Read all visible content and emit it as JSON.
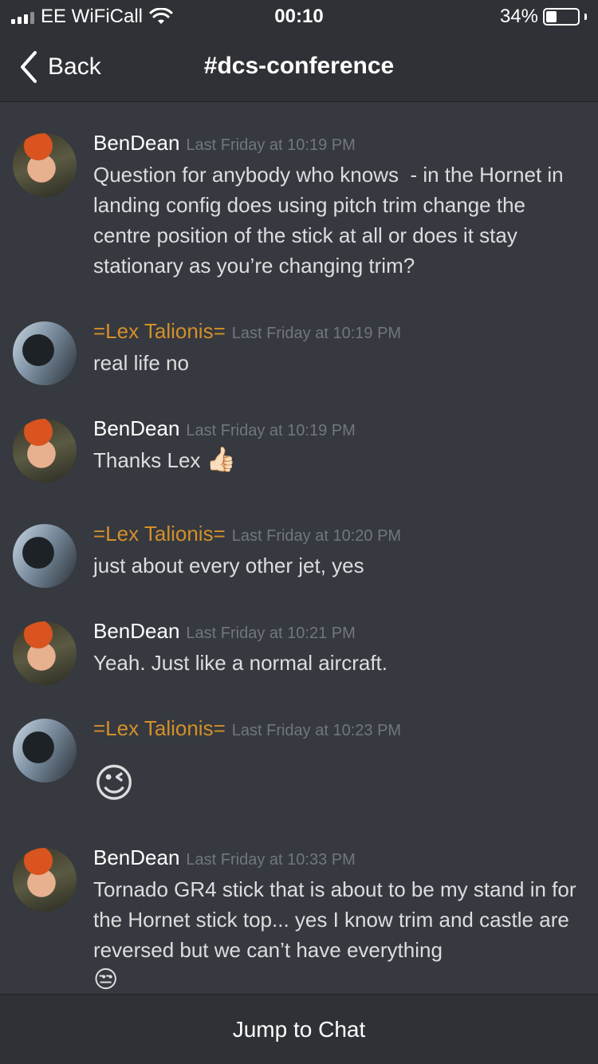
{
  "status_bar": {
    "carrier": "EE WiFiCall",
    "time": "00:10",
    "battery_percent_label": "34%",
    "battery_level": 0.34
  },
  "nav": {
    "back_label": "Back",
    "title": "#dcs-conference"
  },
  "messages": [
    {
      "author": "BenDean",
      "timestamp": "Last Friday at 10:19 PM",
      "text": "Question for anybody who knows  - in the Hornet in landing config does using pitch trim change the centre position of the stick at all or does it stay stationary as you’re changing trim?"
    },
    {
      "author": "=Lex Talionis=",
      "timestamp": "Last Friday at 10:19 PM",
      "text": "real life no"
    },
    {
      "author": "BenDean",
      "timestamp": "Last Friday at 10:19 PM",
      "text": "Thanks Lex",
      "emoji": "👍🏻"
    },
    {
      "author": "=Lex Talionis=",
      "timestamp": "Last Friday at 10:20 PM",
      "text": "just about every other jet, yes"
    },
    {
      "author": "BenDean",
      "timestamp": "Last Friday at 10:21 PM",
      "text": "Yeah. Just like a normal aircraft."
    },
    {
      "author": "=Lex Talionis=",
      "timestamp": "Last Friday at 10:23 PM",
      "emoji": "😉"
    },
    {
      "author": "BenDean",
      "timestamp": "Last Friday at 10:33 PM",
      "text": "Tornado GR4 stick that is about to be my stand in for the Hornet stick top... yes I know trim and castle are reversed but we can’t have everything",
      "emoji": "😒"
    }
  ],
  "footer": {
    "jump_label": "Jump to Chat"
  },
  "colors": {
    "background": "#36393f",
    "bar": "#2f3136",
    "lex_name": "#d4902a",
    "timestamp": "#72767d"
  },
  "icons": [
    "signal-icon",
    "wifi-icon",
    "battery-icon",
    "back-chevron-icon"
  ]
}
